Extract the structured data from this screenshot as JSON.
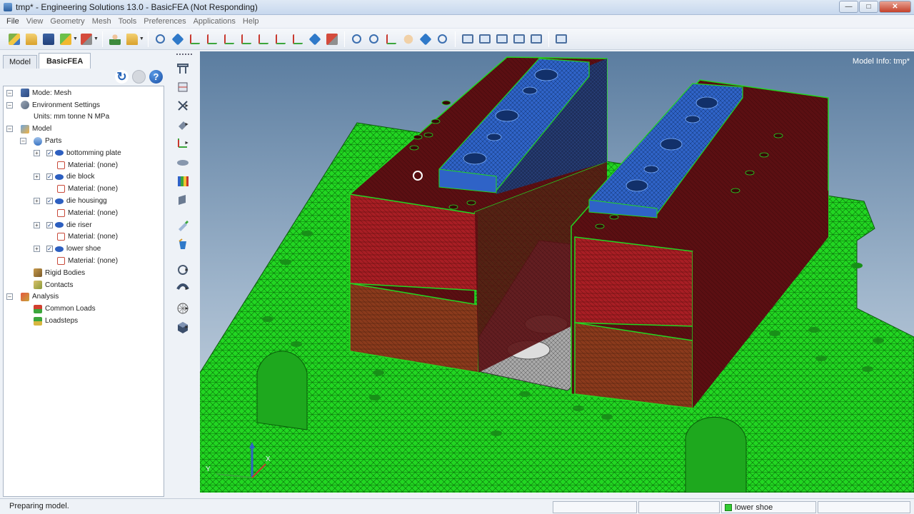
{
  "window": {
    "title": "tmp* - Engineering Solutions 13.0 - BasicFEA (Not Responding)"
  },
  "menu": [
    "File",
    "View",
    "Geometry",
    "Mesh",
    "Tools",
    "Preferences",
    "Applications",
    "Help"
  ],
  "tabs": {
    "model": "Model",
    "basicfea": "BasicFEA"
  },
  "tree": {
    "mode": "Mode: Mesh",
    "env": "Environment Settings",
    "units": "Units: mm tonne N MPa",
    "model": "Model",
    "parts": "Parts",
    "part_items": [
      {
        "name": "bottomming plate",
        "material": "Material: (none)"
      },
      {
        "name": "die block",
        "material": "Material: (none)"
      },
      {
        "name": "die housingg",
        "material": "Material: (none)"
      },
      {
        "name": "die riser",
        "material": "Material: (none)"
      },
      {
        "name": "lower shoe",
        "material": "Material: (none)"
      }
    ],
    "rigid": "Rigid Bodies",
    "contacts": "Contacts",
    "analysis": "Analysis",
    "common_loads": "Common Loads",
    "loadsteps": "Loadsteps"
  },
  "viewport": {
    "model_info": "Model Info: tmp*",
    "axis_x": "X",
    "axis_y": "Y"
  },
  "status": {
    "message": "Preparing model.",
    "selection": "lower shoe"
  },
  "colors": {
    "mesh_green": "#22d622",
    "block_dark_red": "#5a0f12",
    "block_red": "#a81e24",
    "block_brown": "#8a3a1c",
    "plate_blue": "#2f63c7",
    "riser_gray": "#a9a9a9"
  }
}
